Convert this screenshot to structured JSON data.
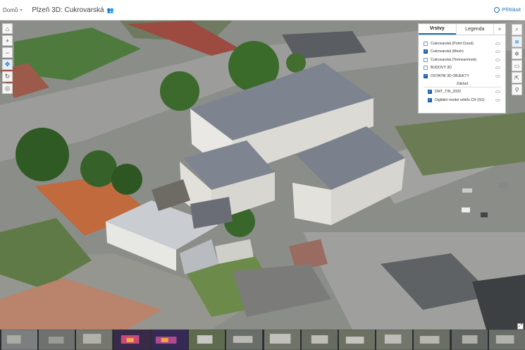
{
  "topbar": {
    "home_label": "Domů",
    "title": "Plzeň 3D: Cukrovarská",
    "login_label": "Přihlásit"
  },
  "left_tools": [
    {
      "name": "home-icon",
      "glyph": "⌂"
    },
    {
      "name": "zoom-in-icon",
      "glyph": "+"
    },
    {
      "name": "zoom-out-icon",
      "glyph": "−"
    },
    {
      "name": "pan-icon",
      "glyph": "✥"
    },
    {
      "name": "rotate-icon",
      "glyph": "↻"
    },
    {
      "name": "compass-icon",
      "glyph": "◎"
    }
  ],
  "right_tools": [
    {
      "name": "search-icon",
      "glyph": "⌕"
    },
    {
      "name": "layers-icon",
      "glyph": "≋"
    },
    {
      "name": "basemap-icon",
      "glyph": "✲"
    },
    {
      "name": "slides-icon",
      "glyph": "▭"
    },
    {
      "name": "share-icon",
      "glyph": "⇱"
    },
    {
      "name": "measure-icon",
      "glyph": "⚲"
    }
  ],
  "layers_panel": {
    "tab_layers": "Vrstvy",
    "tab_legend": "Legenda",
    "close": "×",
    "layers": [
      {
        "label": "Cukrovarská (Point Cloud)",
        "checked": false
      },
      {
        "label": "Cukrovarská (Mesh)",
        "checked": true
      },
      {
        "label": "Cukrovarská (Termosnímek)",
        "checked": false
      },
      {
        "label": "BUDOVY 3D",
        "checked": false
      },
      {
        "label": "OSTATNÍ 3D OBJEKTY",
        "checked": true
      }
    ],
    "section_label": "Základ",
    "base_layers": [
      {
        "label": "DMT_TIN_2020",
        "checked": true
      },
      {
        "label": "Digitální model reliéfu ČR (5G)",
        "checked": true
      }
    ]
  },
  "colors": {
    "accent": "#1a73b8",
    "checkbox": "#1a5fa8"
  }
}
